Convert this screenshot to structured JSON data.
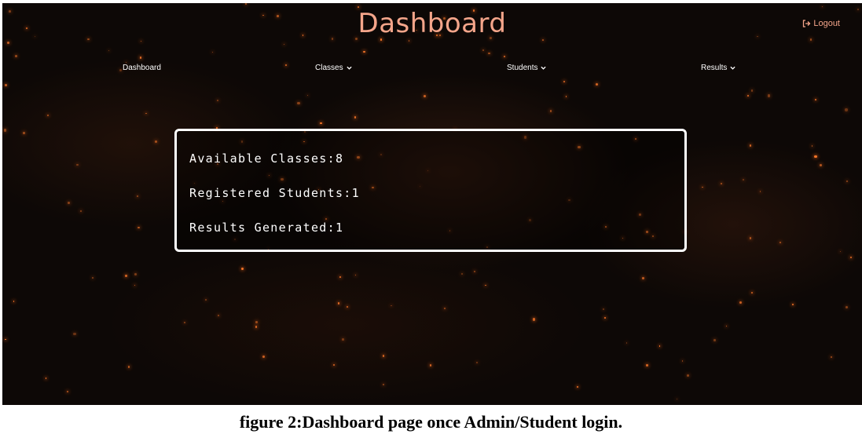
{
  "header": {
    "title": "Dashboard",
    "logout_label": "Logout",
    "logout_icon": "sign-out-icon"
  },
  "nav": {
    "items": [
      {
        "label": "Dashboard",
        "has_dropdown": false
      },
      {
        "label": "Classes",
        "has_dropdown": true
      },
      {
        "label": "Students",
        "has_dropdown": true
      },
      {
        "label": "Results",
        "has_dropdown": true
      }
    ]
  },
  "stats": {
    "available_classes": "Available Classes:8",
    "registered_students": "Registered Students:1",
    "results_generated": "Results Generated:1"
  },
  "caption": "figure 2:Dashboard page once Admin/Student login.",
  "colors": {
    "title": "#f4a58a",
    "background": "#0d0806",
    "accent_particles": "#ff7a2a",
    "text": "#ffffff"
  }
}
